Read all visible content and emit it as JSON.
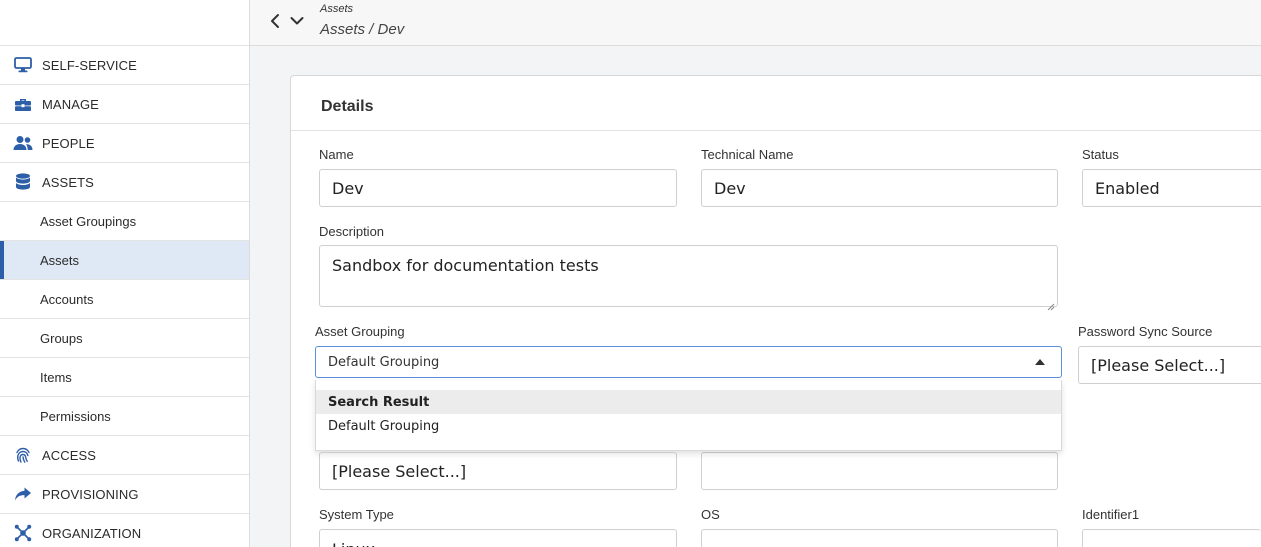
{
  "header": {
    "crumb_small": "Assets",
    "breadcrumb": "Assets / Dev"
  },
  "sidebar": {
    "items": [
      {
        "label": "SELF-SERVICE",
        "icon": "monitor-icon"
      },
      {
        "label": "MANAGE",
        "icon": "toolbox-icon"
      },
      {
        "label": "PEOPLE",
        "icon": "people-icon"
      },
      {
        "label": "ASSETS",
        "icon": "database-icon"
      },
      {
        "label": "Asset Groupings"
      },
      {
        "label": "Assets"
      },
      {
        "label": "Accounts"
      },
      {
        "label": "Groups"
      },
      {
        "label": "Items"
      },
      {
        "label": "Permissions"
      },
      {
        "label": "ACCESS",
        "icon": "fingerprint-icon"
      },
      {
        "label": "PROVISIONING",
        "icon": "share-arrow-icon"
      },
      {
        "label": "ORGANIZATION",
        "icon": "network-icon"
      }
    ]
  },
  "card": {
    "title": "Details",
    "name_label": "Name",
    "name_value": "Dev",
    "tech_label": "Technical Name",
    "tech_value": "Dev",
    "status_label": "Status",
    "status_value": "Enabled",
    "description_label": "Description",
    "description_value": "Sandbox for documentation tests",
    "asset_grouping_label": "Asset Grouping",
    "asset_grouping_value": "Default Grouping",
    "password_sync_label": "Password Sync Source",
    "password_sync_value": "[Please Select...]",
    "row5_left_value": "[Please Select...]",
    "system_type_label": "System Type",
    "system_type_value": "Linux",
    "os_label": "OS",
    "identifier_label": "Identifier1"
  },
  "dropdown": {
    "header": "Search Result",
    "options": [
      "Default Grouping"
    ]
  },
  "colors": {
    "accent": "#2d5ea8",
    "active_bg": "#dfe8f5",
    "focus_border": "#5b8fd6"
  }
}
